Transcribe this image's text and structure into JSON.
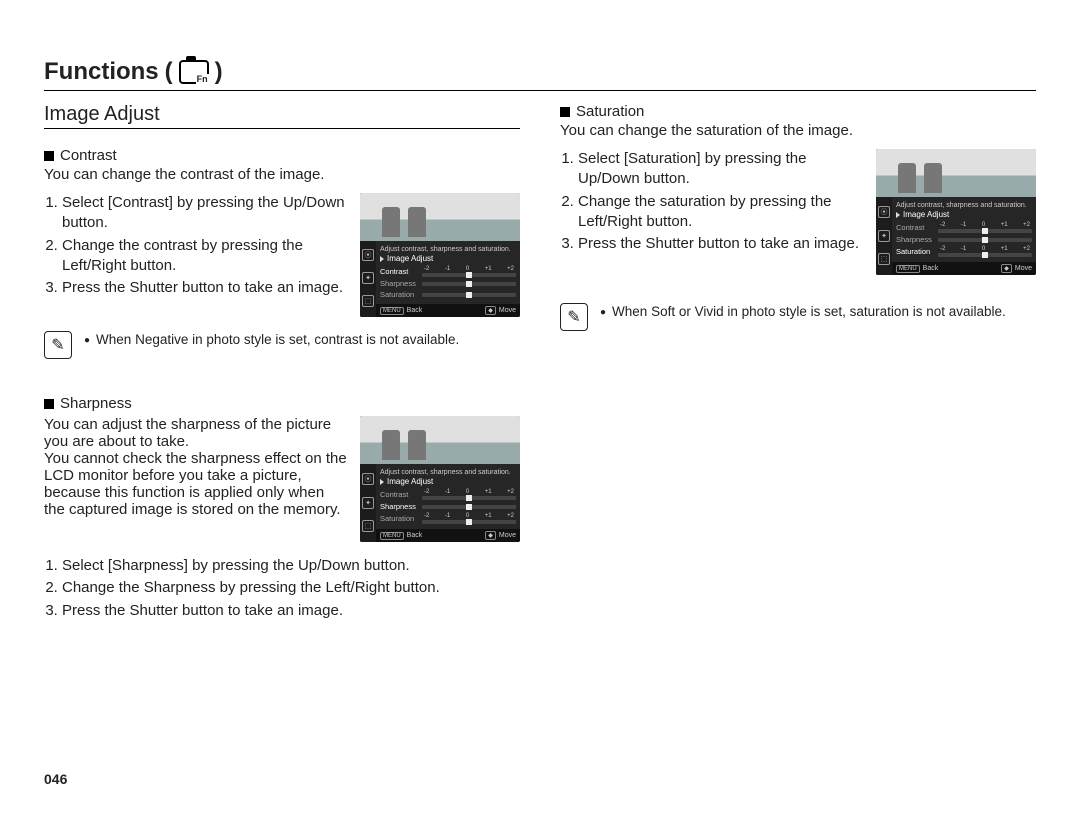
{
  "page_number": "046",
  "title": {
    "text": "Functions",
    "open_paren": "(",
    "close_paren": ")"
  },
  "subtitle": "Image Adjust",
  "icons": {
    "camera_fn": "Fn",
    "note": "✎"
  },
  "lcd_common": {
    "hint_text": "Adjust contrast, sharpness and saturation.",
    "menu_header": "Image Adjust",
    "ticks": [
      "-2",
      "-1",
      "0",
      "+1",
      "+2"
    ],
    "footer_back_key": "MENU",
    "footer_back_label": "Back",
    "footer_move_key": "◆",
    "footer_move_label": "Move",
    "params": [
      {
        "key": "contrast",
        "label": "Contrast"
      },
      {
        "key": "sharpness",
        "label": "Sharpness"
      },
      {
        "key": "saturation",
        "label": "Saturation"
      }
    ]
  },
  "sections": {
    "contrast": {
      "heading": "Contrast",
      "intro": "You can change the contrast of the image.",
      "steps": [
        "Select [Contrast] by pressing the Up/Down button.",
        "Change the contrast by pressing the Left/Right button.",
        "Press the Shutter button to take an image."
      ],
      "note": "When Negative in photo style is set, contrast is not available.",
      "lcd_active": "contrast"
    },
    "sharpness": {
      "heading": "Sharpness",
      "intro_lines": [
        "You can adjust the sharpness of the picture you are about to take.",
        "You cannot check the sharpness effect on the LCD monitor before you take a picture, because this function is applied only when the captured image is stored on the memory."
      ],
      "steps": [
        "Select [Sharpness] by pressing the Up/Down button.",
        "Change the Sharpness by pressing the Left/Right button.",
        "Press the Shutter button to take an image."
      ],
      "lcd_active": "sharpness"
    },
    "saturation": {
      "heading": "Saturation",
      "intro": "You can change the saturation of the image.",
      "steps": [
        "Select [Saturation] by pressing the Up/Down button.",
        "Change the saturation by pressing the Left/Right button.",
        "Press the Shutter button to take an image."
      ],
      "note": "When Soft or Vivid in photo style is set, saturation is not available.",
      "lcd_active": "saturation"
    }
  }
}
